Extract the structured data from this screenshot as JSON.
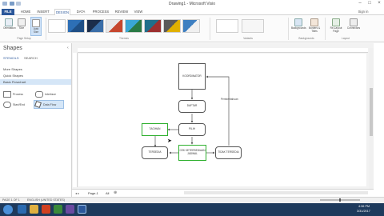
{
  "window": {
    "title": "Drawing1 - Microsoft Visio",
    "user": "Sign in"
  },
  "tabs": [
    "FILE",
    "HOME",
    "INSERT",
    "DESIGN",
    "DATA",
    "PROCESS",
    "REVIEW",
    "VIEW"
  ],
  "ribbon": {
    "buttons": {
      "orientation": "Orientation",
      "size": "Size",
      "autosize": "Auto Size",
      "backgrounds": "Backgrounds",
      "borders": "Borders & Titles",
      "relayout": "Re-Layout Page",
      "connectors": "Connectors"
    },
    "groups": {
      "page_setup": "Page Setup",
      "themes": "Themes",
      "variants": "Variants",
      "backgrounds": "Backgrounds",
      "layout": "Layout"
    }
  },
  "shapes_pane": {
    "title": "Shapes",
    "subtabs": [
      "STENCILS",
      "SEARCH"
    ],
    "stencils": [
      "More Shapes",
      "Quick Shapes",
      "Basic Flowchart"
    ],
    "items": [
      "Process",
      "Start/End",
      "Data Flow",
      "Interface"
    ]
  },
  "diagram": {
    "nodes": {
      "koordinator": "KOORDINATOR",
      "daftar": "DAFTAR",
      "pilih": "PILIH",
      "tagihan": "TAGIHAN",
      "tersedia": "TERSEDIA",
      "cek": "CEK KETERSEDIAAN JADWAL",
      "tidak": "TIDAK TERSEDIA"
    },
    "arrow_label": "Pemberitahuan"
  },
  "pagebar": {
    "page": "Page-1",
    "all": "All"
  },
  "statusbar": {
    "page": "PAGE 1 OF 1",
    "lang": "ENGLISH (UNITED STATES)"
  },
  "taskbar": {
    "time": "4:36 PM",
    "date": "3/31/2017"
  }
}
